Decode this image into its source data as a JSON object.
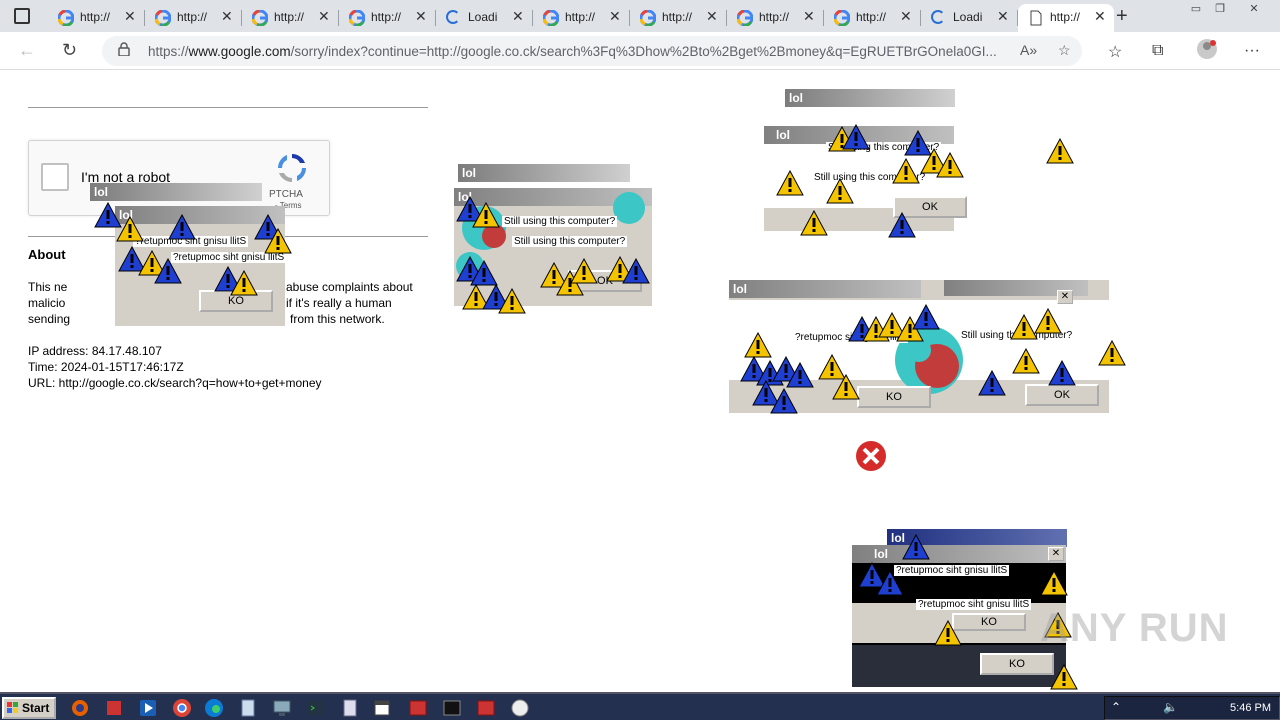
{
  "browser": {
    "tabs": [
      {
        "label": "http://",
        "state": "page"
      },
      {
        "label": "http://",
        "state": "page"
      },
      {
        "label": "http://",
        "state": "page"
      },
      {
        "label": "http://",
        "state": "page"
      },
      {
        "label": "Loadi",
        "state": "loading"
      },
      {
        "label": "http://",
        "state": "page"
      },
      {
        "label": "http://",
        "state": "page"
      },
      {
        "label": "http://",
        "state": "page"
      },
      {
        "label": "http://",
        "state": "page"
      },
      {
        "label": "Loadi",
        "state": "loading"
      },
      {
        "label": "http://",
        "state": "active"
      }
    ],
    "url_prefix": "https://",
    "url_domain": "www.google.com",
    "url_rest": "/sorry/index?continue=http://google.co.ck/search%3Fq%3Dhow%2Bto%2Bget%2Bmoney&q=EgRUETBrGOnela0GI..."
  },
  "page": {
    "captcha_label": "I'm not a robot",
    "captcha_brand": "PTCHA",
    "captcha_terms": "- Terms",
    "about_heading": "About",
    "about_line1_a": "This ne",
    "about_line1_b": "abuse complaints about",
    "about_line2_a": "malicio",
    "about_line2_b": "if it's really a human",
    "about_line3_a": "sending",
    "about_line3_b": "from this network.",
    "ip_line": "IP address: 84.17.48.107",
    "time_line": "Time: 2024-01-15T17:46:17Z",
    "url_line": "URL: http://google.co.ck/search?q=how+to+get+money"
  },
  "dialogs": {
    "title": "lol",
    "msg_forward": "Still using this computer?",
    "msg_reverse": "?retupmoc siht gnisu llitS",
    "ok": "OK",
    "ko": "KO",
    "close": "✕"
  },
  "taskbar": {
    "start_label": "Start",
    "clock": "5:46 PM"
  },
  "watermark": "ANY RUN",
  "colors": {
    "titlebar_inactive": "#808080",
    "titlebar_active": "#0a246a",
    "dialog_face": "#d4d0c8",
    "taskbar": "#24304f",
    "warning_yellow": "#f5c400",
    "warning_blue": "#1e3fd0",
    "error_red": "#d52b2b"
  }
}
